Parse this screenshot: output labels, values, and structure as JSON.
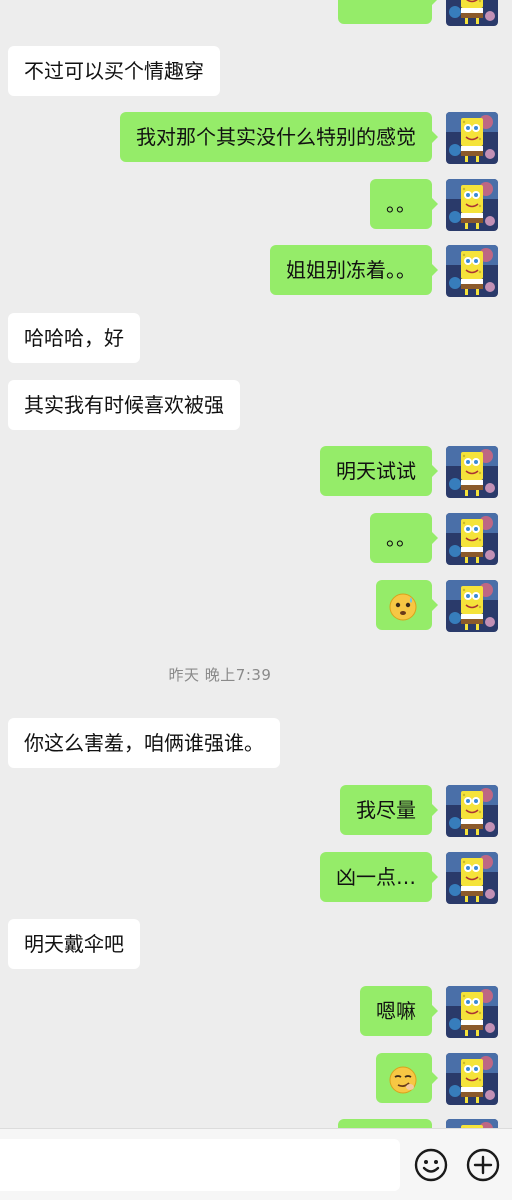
{
  "conversation": {
    "messages": [
      {
        "side": "left",
        "text": "不过可以买个情趣穿"
      },
      {
        "side": "right",
        "text": "我对那个其实没什么特别的感觉"
      },
      {
        "side": "right",
        "text": "。。"
      },
      {
        "side": "right",
        "text": "姐姐别冻着。。"
      },
      {
        "side": "left",
        "text": "哈哈哈，好"
      },
      {
        "side": "left",
        "text": "其实我有时候喜欢被强"
      },
      {
        "side": "right",
        "text": "明天试试"
      },
      {
        "side": "right",
        "text": "。。"
      },
      {
        "side": "right",
        "emoji": "awkward-emoji"
      },
      {
        "side": "left",
        "text": "你这么害羞，咱俩谁强谁。"
      },
      {
        "side": "right",
        "text": "我尽量"
      },
      {
        "side": "right",
        "text": "凶一点…"
      },
      {
        "side": "left",
        "text": "明天戴伞吧"
      },
      {
        "side": "right",
        "text": "嗯嘛"
      },
      {
        "side": "right",
        "emoji": "smirk-emoji"
      }
    ],
    "timestamp": "昨天 晚上7:39"
  },
  "input_bar": {
    "placeholder": "",
    "emoji_button_icon": "smiley-face-icon",
    "more_button_icon": "plus-circle-icon"
  },
  "colors": {
    "background": "#ededed",
    "self_bubble": "#95ec69",
    "other_bubble": "#ffffff",
    "avatar_bg": "#2a3a6a",
    "sponge": "#f5e33a"
  }
}
